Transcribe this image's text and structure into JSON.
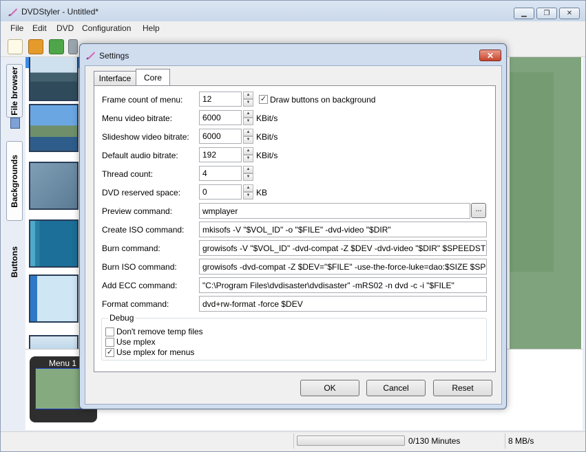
{
  "window": {
    "title": "DVDStyler - Untitled*"
  },
  "menubar": [
    "File",
    "Edit",
    "DVD",
    "Configuration",
    "Help"
  ],
  "left_tabs": {
    "file_browser": "File browser",
    "backgrounds": "Backgrounds",
    "buttons": "Buttons"
  },
  "menu_card": {
    "label": "Menu 1"
  },
  "status": {
    "progress_fraction": 0.0,
    "minutes": "0/130 Minutes",
    "rate": "8 MB/s"
  },
  "dialog": {
    "title": "Settings",
    "close_glyph": "✕",
    "tabs": [
      "Interface",
      "Core"
    ],
    "active_tab": "Core",
    "fields": {
      "frame_count": {
        "label": "Frame count of menu:",
        "value": "12"
      },
      "menu_bitrate": {
        "label": "Menu video bitrate:",
        "value": "6000",
        "unit": "KBit/s"
      },
      "slideshow_bitrate": {
        "label": "Slideshow video bitrate:",
        "value": "6000",
        "unit": "KBit/s"
      },
      "audio_bitrate": {
        "label": "Default audio bitrate:",
        "value": "192",
        "unit": "KBit/s"
      },
      "thread_count": {
        "label": "Thread count:",
        "value": "4"
      },
      "reserved_space": {
        "label": "DVD reserved space:",
        "value": "0",
        "unit": "KB"
      }
    },
    "draw_buttons": {
      "label": "Draw buttons on background",
      "checked": true
    },
    "commands": {
      "preview": {
        "label": "Preview command:",
        "value": "wmplayer"
      },
      "create_iso": {
        "label": "Create ISO command:",
        "value": "mkisofs -V \"$VOL_ID\" -o \"$FILE\" -dvd-video \"$DIR\""
      },
      "burn": {
        "label": "Burn command:",
        "value": "growisofs -V \"$VOL_ID\" -dvd-compat -Z $DEV -dvd-video \"$DIR\" $SPEEDSTR"
      },
      "burn_iso": {
        "label": "Burn ISO command:",
        "value": "growisofs -dvd-compat -Z $DEV=\"$FILE\" -use-the-force-luke=dao:$SIZE $SPEEDSTR"
      },
      "add_ecc": {
        "label": "Add ECC command:",
        "value": "\"C:\\Program Files\\dvdisaster\\dvdisaster\" -mRS02 -n dvd -c -i \"$FILE\""
      },
      "format": {
        "label": "Format command:",
        "value": "dvd+rw-format -force $DEV"
      }
    },
    "browse_label": "...",
    "debug": {
      "title": "Debug",
      "options": [
        {
          "label": "Don't remove temp files",
          "checked": false
        },
        {
          "label": "Use mplex",
          "checked": false
        },
        {
          "label": "Use mplex for menus",
          "checked": true
        }
      ]
    },
    "buttons": {
      "ok": "OK",
      "cancel": "Cancel",
      "reset": "Reset"
    }
  },
  "colors": {
    "progress": "#3cc35a",
    "preview": "#7fa47d",
    "close": "#c7442c"
  }
}
